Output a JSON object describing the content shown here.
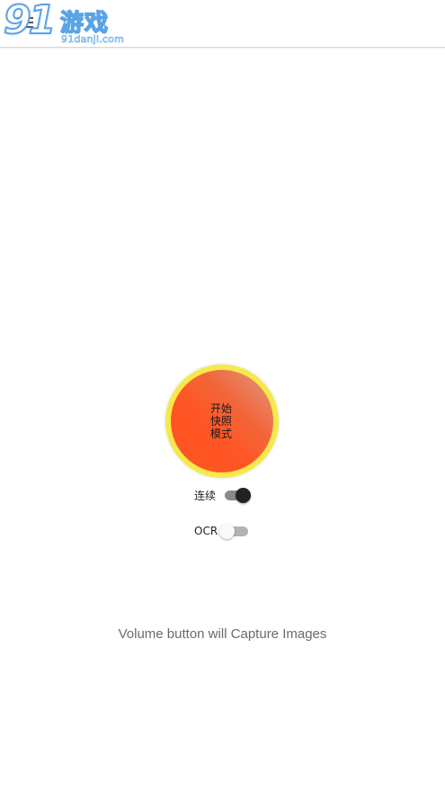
{
  "app": {
    "menu_icon": "hamburger-menu-icon"
  },
  "watermark": {
    "number": "91",
    "chinese": "游戏",
    "domain": "91danji.com"
  },
  "capture": {
    "label": "开始快照模式",
    "colors": {
      "ring": "#f7e94a",
      "fill": "#ff5524"
    }
  },
  "toggles": [
    {
      "label": "连续",
      "state": "on"
    },
    {
      "label": "OCR",
      "state": "off"
    }
  ],
  "hint": "Volume button will Capture Images"
}
